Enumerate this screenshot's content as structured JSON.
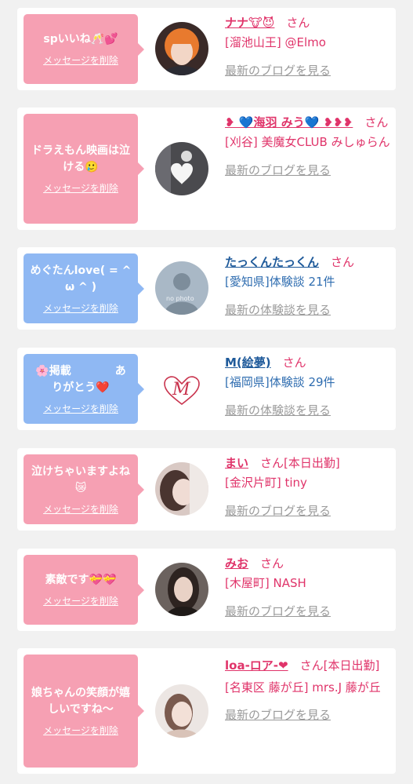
{
  "delete_label": "メッセージを削除",
  "suffix_san": "さん",
  "cards": [
    {
      "message": "spいいね🥂💕",
      "name": "ナナ🐮😈",
      "shop": "[溜池山王] @Elmo",
      "link": "最新のブログを見る"
    },
    {
      "message": "ドラえもん映画は泣ける🥲",
      "name": "❥ 💙海羽 みう💙 ❥❥❥",
      "shop": "[刈谷] 美魔女CLUB みしゅらん",
      "link": "最新のブログを見る"
    },
    {
      "message": "めぐたんlove( = ^ ω ^ )",
      "name": "たっくんたっくん",
      "shop": "[愛知県]体験談 21件",
      "link": "最新の体験談を見る",
      "avatar_text": "no photo"
    },
    {
      "message": "🌸掲載　　　　あ りがとう❤️",
      "name": "M(絵夢)",
      "shop": "[福岡県]体験談 29件",
      "link": "最新の体験談を見る"
    },
    {
      "message": "泣けちゃいますよね😿",
      "name": "まい",
      "tag": "[本日出勤]",
      "shop": "[金沢片町] tiny",
      "link": "最新のブログを見る"
    },
    {
      "message": "素敵です💝💝",
      "name": "みお",
      "shop": "[木屋町] NASH",
      "link": "最新のブログを見る"
    },
    {
      "message": "娘ちゃんの笑顔が嬉しいですね〜",
      "name": "loa-ロア-❤",
      "tag": "[本日出勤]",
      "shop": "[名東区 藤が丘] mrs.J 藤が丘",
      "link": "最新のブログを見る"
    }
  ]
}
